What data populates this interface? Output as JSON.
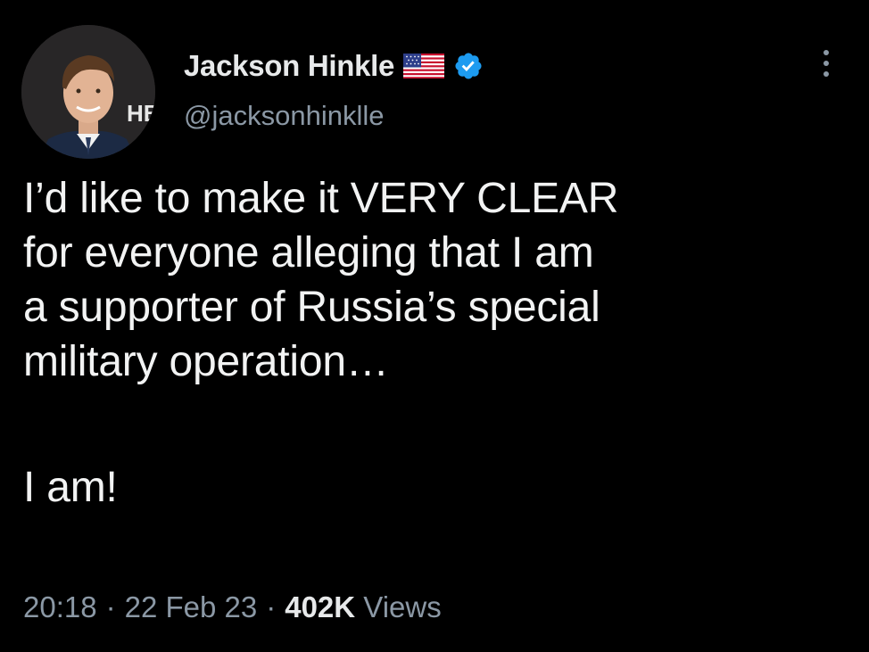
{
  "author": {
    "display_name": "Jackson Hinkle",
    "handle": "@jacksonhinklle",
    "avatar_icon": "profile-photo",
    "flag_icon": "us-flag-icon",
    "verified_icon": "verified-badge-icon",
    "avatar_backdrop_text": "HB"
  },
  "menu": {
    "icon": "more-options-icon"
  },
  "tweet": {
    "lines": [
      "I’d like to make it VERY CLEAR",
      "for everyone alleging that I am",
      "a supporter of Russia’s special",
      "military operation…",
      "I am!"
    ]
  },
  "meta": {
    "time": "20:18",
    "separator": "·",
    "date": "22 Feb 23",
    "views_count": "402K",
    "views_label": "Views"
  },
  "colors": {
    "background": "#000000",
    "text": "#e7e9ea",
    "secondary": "#8b98a5",
    "verified": "#1d9bf0"
  }
}
